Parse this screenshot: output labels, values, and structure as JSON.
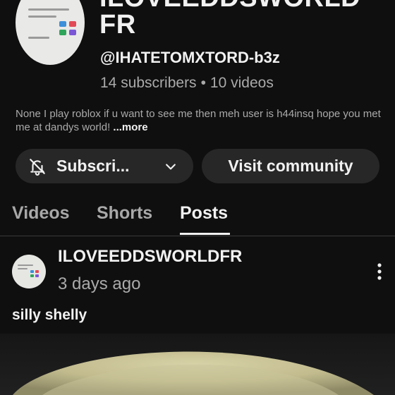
{
  "channel": {
    "name_line1_cut": "ILOVEEDDSWORLD",
    "name_line2": "FR",
    "handle": "@IHATETOMXTORD-b3z",
    "subscribers": "14 subscribers",
    "separator": "•",
    "videos": "10 videos",
    "bio": "None I play roblox if u want to see me then meh user is h44insq hope you met me at dandys world!",
    "bio_more": "...more"
  },
  "actions": {
    "subscribe_label": "Subscri...",
    "community_label": "Visit community"
  },
  "tabs": [
    {
      "label": "Videos",
      "active": false
    },
    {
      "label": "Shorts",
      "active": false
    },
    {
      "label": "Posts",
      "active": true
    }
  ],
  "post": {
    "author": "ILOVEEDDSWORLDFR",
    "time": "3 days ago",
    "text": "silly shelly"
  },
  "colors": {
    "background": "#0f0f0f",
    "button_bg": "#272727",
    "text_primary": "#f1f1f1",
    "text_secondary": "#aaaaaa"
  }
}
